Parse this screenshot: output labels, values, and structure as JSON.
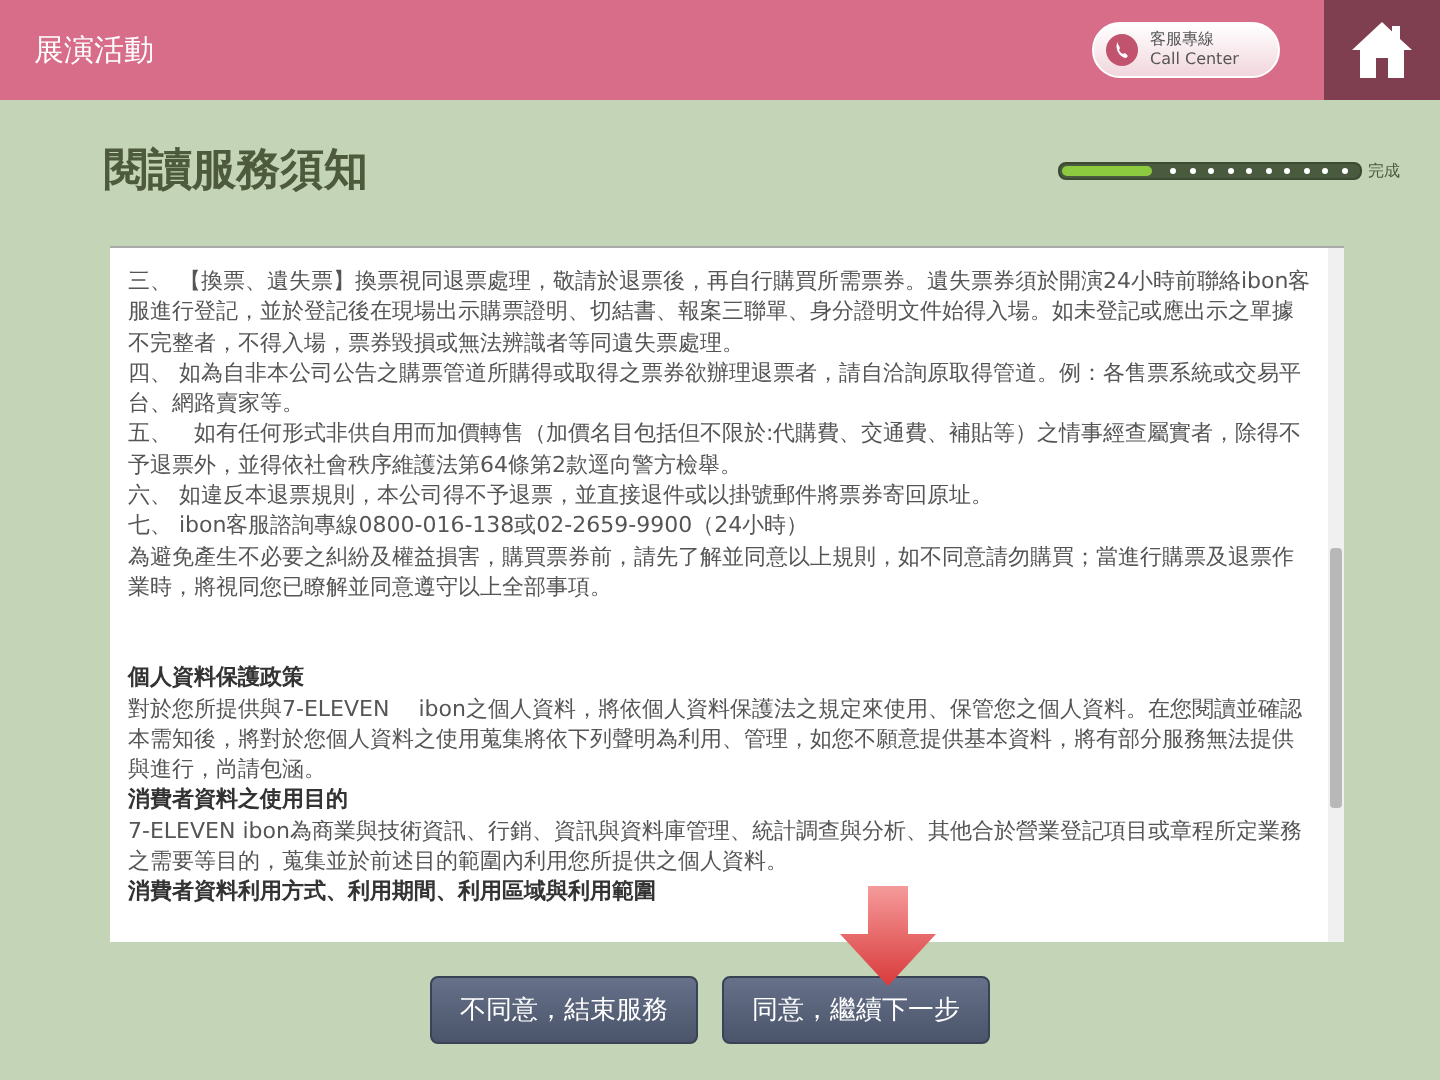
{
  "header": {
    "title": "展演活動",
    "call_center": {
      "line_1": "客服專線",
      "line_2": "Call Center"
    }
  },
  "page_title": "閱讀服務須知",
  "progress": {
    "level": 0.3,
    "label": "完成"
  },
  "notice": [
    {
      "kind": "body",
      "text": "三、 【換票、遺失票】換票視同退票處理，敬請於退票後，再自行購買所需票券。遺失票券須於開演24小時前聯絡ibon客服進行登記，並於登記後在現場出示購票證明、切結書、報案三聯單、身分證明文件始得入場。如未登記或應出示之單據不完整者，不得入場，票券毀損或無法辨識者等同遺失票處理。"
    },
    {
      "kind": "body",
      "text": "四、 如為自非本公司公告之購票管道所購得或取得之票券欲辦理退票者，請自洽詢原取得管道。例：各售票系統或交易平台、網路賣家等。"
    },
    {
      "kind": "body",
      "text": "五、　如有任何形式非供自用而加價轉售（加價名目包括但不限於:代購費、交通費、補貼等）之情事經查屬實者，除得不予退票外，並得依社會秩序維護法第64條第2款逕向警方檢舉。"
    },
    {
      "kind": "body",
      "text": "六、 如違反本退票規則，本公司得不予退票，並直接退件或以掛號郵件將票券寄回原址。"
    },
    {
      "kind": "body",
      "text": "七、 ibon客服諮詢專線0800-016-138或02-2659-9900（24小時）"
    },
    {
      "kind": "body",
      "text": "為避免產生不必要之糾紛及權益損害，購買票券前，請先了解並同意以上規則，如不同意請勿購買；當進行購票及退票作業時，將視同您已瞭解並同意遵守以上全部事項。"
    },
    {
      "kind": "heading",
      "text": "個人資料保護政策"
    },
    {
      "kind": "body",
      "text": "對於您所提供與7-ELEVEN　 ibon之個人資料，將依個人資料保護法之規定來使用、保管您之個人資料。在您閱讀並確認本需知後，將對於您個人資料之使用蒐集將依下列聲明為利用、管理，如您不願意提供基本資料，將有部分服務無法提供與進行，尚請包涵。"
    },
    {
      "kind": "heading",
      "text": "消費者資料之使用目的"
    },
    {
      "kind": "body",
      "text": "7-ELEVEN ibon為商業與技術資訊、行銷、資訊與資料庫管理、統計調查與分析、其他合於營業登記項目或章程所定業務之需要等目的，蒐集並於前述目的範圍內利用您所提供之個人資料。"
    },
    {
      "kind": "heading",
      "text": "消費者資料利用方式、利用期間、利用區域與利用範圍"
    }
  ],
  "buttons": [
    {
      "label": "不同意，結束服務"
    },
    {
      "label": "同意，繼續下一步"
    }
  ]
}
